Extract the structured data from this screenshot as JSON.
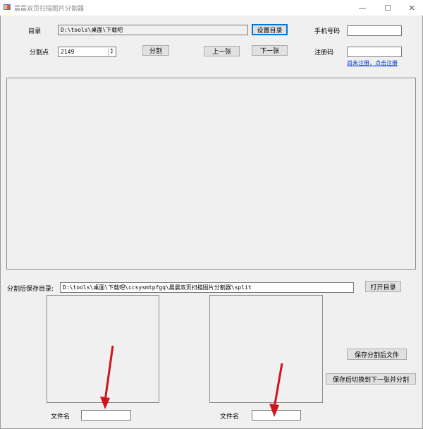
{
  "window": {
    "title": "晨晨双页扫描图片分割器",
    "controls": {
      "minimize": "—",
      "maximize": "☐",
      "close": "✕"
    }
  },
  "form": {
    "dir_label": "目录",
    "dir_value": "D:\\tools\\桌面\\下载吧",
    "set_dir_button": "设置目录",
    "split_point_label": "分割点",
    "split_point_value": "2149",
    "split_button": "分割",
    "prev_button": "上一张",
    "next_button": "下一张",
    "phone_label": "手机号码",
    "phone_value": "",
    "regcode_label": "注册码",
    "regcode_value": "",
    "register_link": "尚未注册，点击注册"
  },
  "save": {
    "save_dir_label": "分割后保存目录:",
    "save_dir_value": "D:\\tools\\桌面\\下载吧\\ccsysmtpfgq\\晨晨双页扫描图片分割器\\split",
    "open_dir_button": "打开目录",
    "save_split_button": "保存分割后文件",
    "save_next_button": "保存后切换到下一张并分割",
    "left_filename_label": "文件名",
    "left_filename_value": "",
    "right_filename_label": "文件名",
    "right_filename_value": ""
  },
  "colors": {
    "annotation_arrow": "#d0141c",
    "link": "#0033cc",
    "focus": "#0078d7"
  }
}
